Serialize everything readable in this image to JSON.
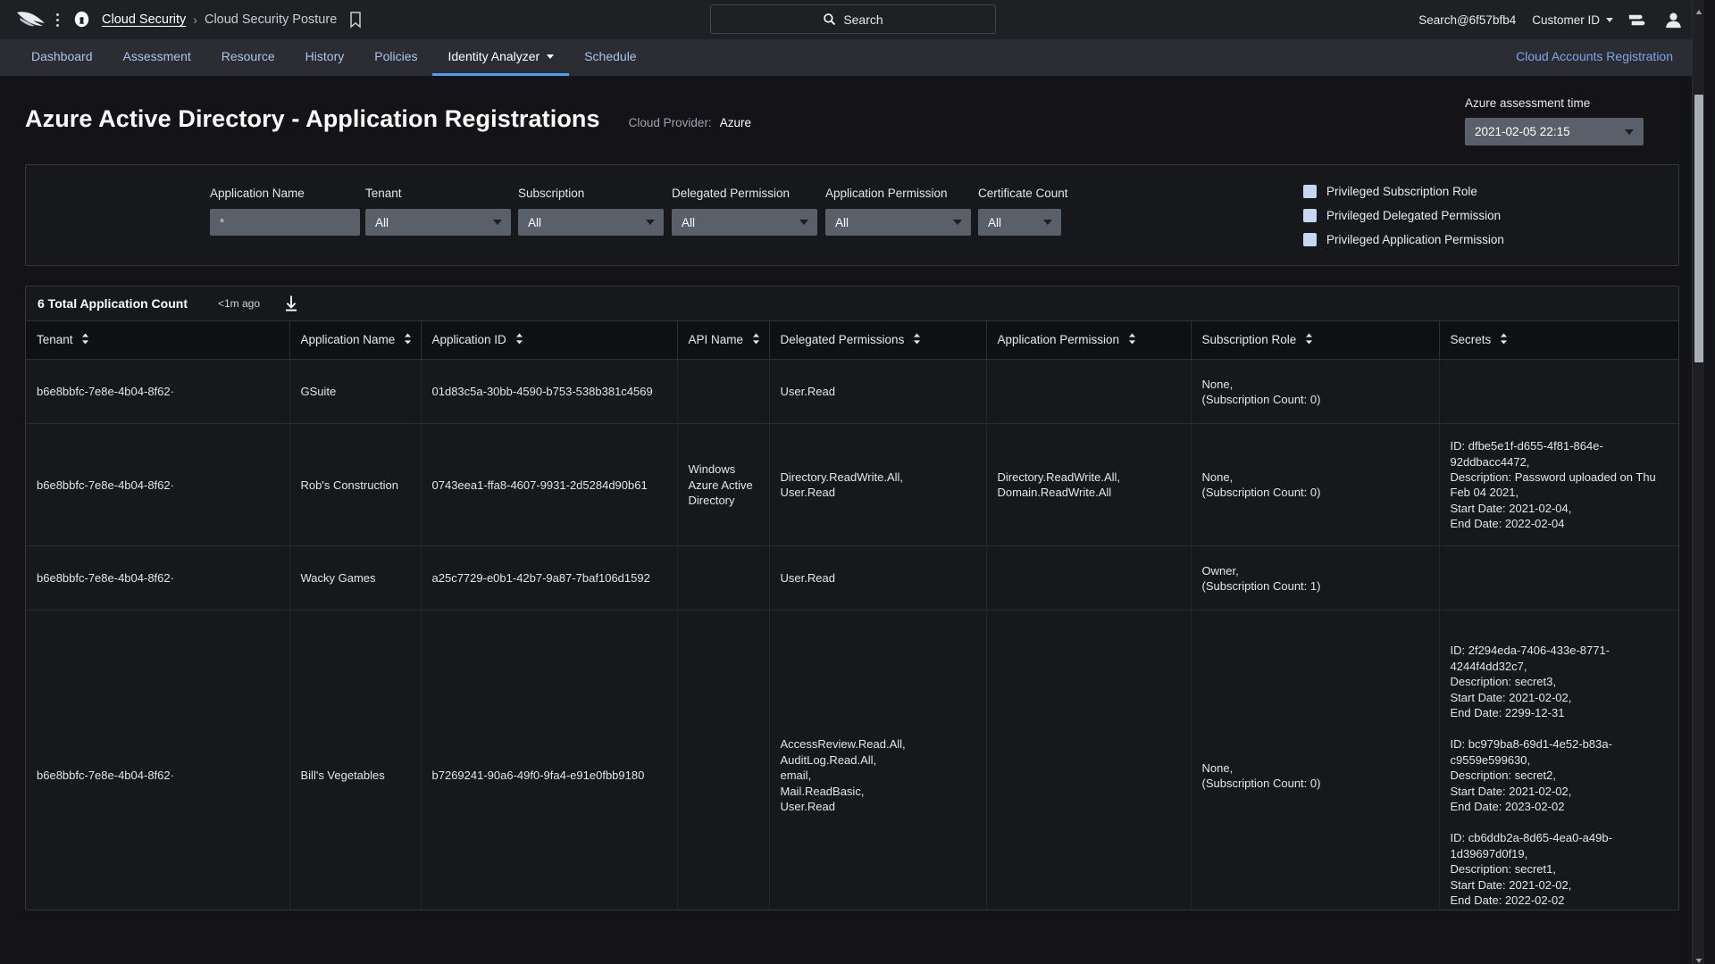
{
  "topbar": {
    "breadcrumb_link": "Cloud Security",
    "breadcrumb_separator": "›",
    "breadcrumb_current": "Cloud Security Posture",
    "search_label": "Search",
    "user_email": "Search@6f57bfb4",
    "customer_id_label": "Customer ID"
  },
  "nav": {
    "items": [
      {
        "label": "Dashboard",
        "active": false,
        "caret": false
      },
      {
        "label": "Assessment",
        "active": false,
        "caret": false
      },
      {
        "label": "Resource",
        "active": false,
        "caret": false
      },
      {
        "label": "History",
        "active": false,
        "caret": false
      },
      {
        "label": "Policies",
        "active": false,
        "caret": false
      },
      {
        "label": "Identity Analyzer",
        "active": true,
        "caret": true
      },
      {
        "label": "Schedule",
        "active": false,
        "caret": false
      }
    ],
    "right_link": "Cloud Accounts Registration"
  },
  "header": {
    "page_title": "Azure Active Directory - Application Registrations",
    "cloud_provider_label": "Cloud Provider:",
    "cloud_provider_value": "Azure",
    "assessment_time_label": "Azure assessment time",
    "assessment_time_value": "2021-02-05 22:15"
  },
  "filters": {
    "fields": [
      {
        "label": "Application Name",
        "value": "*",
        "type": "input"
      },
      {
        "label": "Tenant",
        "value": "All",
        "type": "select"
      },
      {
        "label": "Subscription",
        "value": "All",
        "type": "select"
      },
      {
        "label": "Delegated Permission",
        "value": "All",
        "type": "select"
      },
      {
        "label": "Application Permission",
        "value": "All",
        "type": "select"
      },
      {
        "label": "Certificate Count",
        "value": "All",
        "type": "select"
      }
    ],
    "checkboxes": [
      {
        "label": "Privileged Subscription Role",
        "checked": false
      },
      {
        "label": "Privileged Delegated Permission",
        "checked": false
      },
      {
        "label": "Privileged Application Permission",
        "checked": false
      }
    ]
  },
  "table": {
    "count_label": "6 Total Application Count",
    "updated_label": "<1m ago",
    "columns": [
      "Tenant",
      "Application Name",
      "Application ID",
      "API Name",
      "Delegated Permissions",
      "Application Permission",
      "Subscription Role",
      "Secrets"
    ],
    "rows": [
      {
        "tenant": "b6e8bbfc-7e8e-4b04-8f62·",
        "app_name": "GSuite",
        "app_id": "01d83c5a-30bb-4590-b753-538b381c4569",
        "api_name": "",
        "delegated": "User.Read",
        "app_permission": "",
        "subscription_role": "None,\n(Subscription Count: 0)",
        "secrets": ""
      },
      {
        "tenant": "b6e8bbfc-7e8e-4b04-8f62·",
        "app_name": "Rob's Construction",
        "app_id": "0743eea1-ffa8-4607-9931-2d5284d90b61",
        "api_name": "Windows Azure Active Directory",
        "delegated": "Directory.ReadWrite.All,\nUser.Read",
        "app_permission": "Directory.ReadWrite.All,\nDomain.ReadWrite.All",
        "subscription_role": "None,\n(Subscription Count: 0)",
        "secrets": "ID: dfbe5e1f-d655-4f81-864e-92ddbacc4472,\nDescription: Password uploaded on Thu Feb 04 2021,\nStart Date: 2021-02-04,\nEnd Date: 2022-02-04"
      },
      {
        "tenant": "b6e8bbfc-7e8e-4b04-8f62·",
        "app_name": "Wacky Games",
        "app_id": "a25c7729-e0b1-42b7-9a87-7baf106d1592",
        "api_name": "",
        "delegated": "User.Read",
        "app_permission": "",
        "subscription_role": "Owner,\n(Subscription Count: 1)",
        "secrets": ""
      },
      {
        "tenant": "b6e8bbfc-7e8e-4b04-8f62·",
        "app_name": "Bill's Vegetables",
        "app_id": "b7269241-90a6-49f0-9fa4-e91e0fbb9180",
        "api_name": "",
        "delegated": "AccessReview.Read.All,\nAuditLog.Read.All,\nemail,\nMail.ReadBasic,\nUser.Read",
        "app_permission": "",
        "subscription_role": "None,\n(Subscription Count: 0)",
        "secrets": "ID: 2f294eda-7406-433e-8771-4244f4dd32c7,\nDescription: secret3,\nStart Date: 2021-02-02,\nEnd Date: 2299-12-31\n\nID: bc979ba8-69d1-4e52-b83a-c9559e599630,\nDescription: secret2,\nStart Date: 2021-02-02,\nEnd Date: 2023-02-02\n\nID: cb6ddb2a-8d65-4ea0-a49b-1d39697d0f19,\nDescription: secret1,\nStart Date: 2021-02-02,\nEnd Date: 2022-02-02"
      }
    ]
  },
  "colors": {
    "accent_blue": "#4e9ff5",
    "nav_link": "#a8c4f0",
    "control_gray": "#5a6069",
    "checkbox_blue": "#c7d6f5",
    "page_bg": "#141418"
  }
}
